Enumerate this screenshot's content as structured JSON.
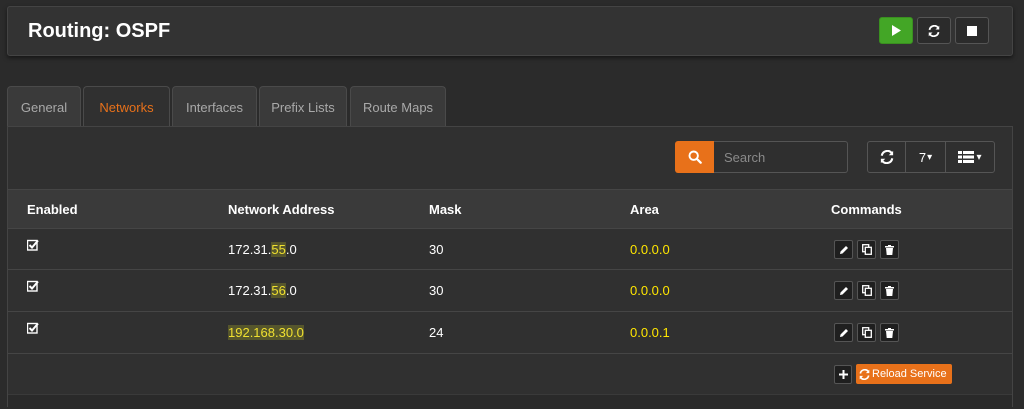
{
  "header": {
    "title": "Routing: OSPF",
    "buttons": [
      {
        "name": "start-service",
        "icon": "play-icon",
        "color": "#43a626"
      },
      {
        "name": "restart-service",
        "icon": "refresh-icon"
      },
      {
        "name": "stop-service",
        "icon": "stop-icon"
      }
    ]
  },
  "tabs": [
    {
      "label": "General",
      "active": false
    },
    {
      "label": "Networks",
      "active": true
    },
    {
      "label": "Interfaces",
      "active": false
    },
    {
      "label": "Prefix Lists",
      "active": false
    },
    {
      "label": "Route Maps",
      "active": false
    }
  ],
  "toolbar": {
    "search_placeholder": "Search",
    "search_value": "",
    "page_size": "7",
    "page_size_caret": "▾",
    "search_icon": "search-icon",
    "refresh_icon": "refresh-icon",
    "columns_icon": "columns-icon",
    "accent_color": "#e8711a"
  },
  "table": {
    "columns": [
      "Enabled",
      "Network Address",
      "Mask",
      "Area",
      "Commands"
    ],
    "rows": [
      {
        "enabled": true,
        "address_prefix": "172.31.",
        "address_highlight": "55",
        "address_suffix": ".0",
        "mask": "30",
        "area": "0.0.0.0"
      },
      {
        "enabled": true,
        "address_prefix": "172.31.",
        "address_highlight": "56",
        "address_suffix": ".0",
        "mask": "30",
        "area": "0.0.0.0"
      },
      {
        "enabled": true,
        "address_prefix": "",
        "address_highlight": "192.168.30.0",
        "address_suffix": "",
        "mask": "24",
        "area": "0.0.0.1"
      }
    ],
    "row_commands": [
      "edit-icon",
      "copy-icon",
      "delete-icon"
    ]
  },
  "footer": {
    "add_icon": "plus-icon",
    "reload_label": "Reload Service",
    "reload_icon": "refresh-icon"
  }
}
